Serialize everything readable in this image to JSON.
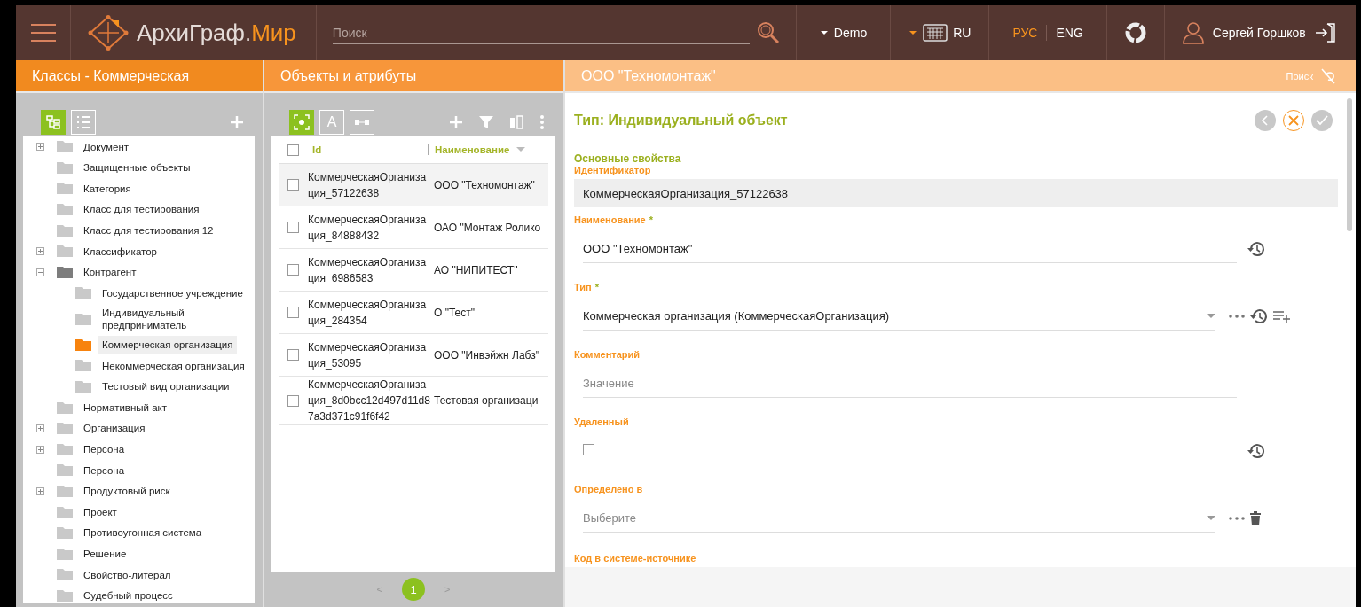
{
  "header": {
    "logo": {
      "name": "АрхиГраф.",
      "accent": "Мир"
    },
    "search": {
      "placeholder": "Поиск"
    },
    "workspace": "Demo",
    "keyboard": "RU",
    "languages": [
      {
        "label": "РУС",
        "selected": true
      },
      {
        "label": "ENG",
        "selected": false
      }
    ],
    "user": "Сергей Горшков"
  },
  "classes_panel": {
    "title": "Классы - Коммерческая",
    "views": [
      {
        "kind": "tree",
        "selected": true
      },
      {
        "kind": "list",
        "selected": false
      }
    ],
    "tree": [
      {
        "label": "Документ",
        "expanded": false
      },
      {
        "label": "Защищенные объекты"
      },
      {
        "label": "Категория"
      },
      {
        "label": "Класс для тестирования"
      },
      {
        "label": "Класс для тестирования 12"
      },
      {
        "label": "Классификатор",
        "expanded": false
      },
      {
        "label": "Контрагент",
        "expanded": true,
        "children": [
          {
            "label": "Государственное учреждение",
            "selected": false
          },
          {
            "label": "Индивидуальный предприниматель",
            "selected": false
          },
          {
            "label": "Коммерческая организация",
            "selected": true
          },
          {
            "label": "Некоммерческая организация",
            "selected": false
          },
          {
            "label": "Тестовый вид организации",
            "selected": false
          }
        ]
      },
      {
        "label": "Нормативный акт"
      },
      {
        "label": "Организация",
        "expanded": false
      },
      {
        "label": "Персона",
        "expanded": false
      },
      {
        "label": "Персона"
      },
      {
        "label": "Продуктовый риск",
        "expanded": false
      },
      {
        "label": "Проект"
      },
      {
        "label": "Противоугонная система"
      },
      {
        "label": "Решение"
      },
      {
        "label": "Свойство-литерал"
      },
      {
        "label": "Судебный процесс"
      }
    ]
  },
  "objects_panel": {
    "title": "Объекты и атрибуты",
    "views": [
      {
        "kind": "object",
        "selected": true
      },
      {
        "kind": "text",
        "label": "A",
        "selected": false
      },
      {
        "kind": "link",
        "selected": false
      }
    ],
    "table": {
      "columns": [
        "Id",
        "Наименование"
      ],
      "all_checked": false,
      "rows": [
        {
          "id": "КоммерческаяОрганизация_57122638",
          "name": "ООО \"Техномонтаж\"",
          "checked": false,
          "selected": true
        },
        {
          "id": "КоммерческаяОрганизация_84888432",
          "name": "ОАО \"Монтаж Ролико",
          "checked": false,
          "selected": false
        },
        {
          "id": "КоммерческаяОрганизация_6986583",
          "name": "АО \"НИПИТЕСТ\"",
          "checked": false,
          "selected": false
        },
        {
          "id": "КоммерческаяОрганизация_284354",
          "name": "О \"Тест\"",
          "checked": false,
          "selected": false
        },
        {
          "id": "КоммерческаяОрганизация_53095",
          "name": "ООО \"Инвэйжн Лабз\"",
          "checked": false,
          "selected": false
        },
        {
          "id": "КоммерческаяОрганизация_8d0bcc12d497d11d87a3d371c91f6f42",
          "name": "Тестовая организаци",
          "checked": false,
          "selected": false
        }
      ]
    },
    "pagination": {
      "prev": "<",
      "pages": [
        {
          "label": "1",
          "selected": true
        }
      ],
      "next": ">"
    }
  },
  "details_panel": {
    "title": "ООО \"Техномонтаж\"",
    "search": "Поиск",
    "heading": "Тип: Индивидуальный объект",
    "section": "Основные свойства",
    "fields": [
      {
        "kind": "readonly",
        "label": "Идентификатор",
        "value": "КоммерческаяОрганизация_57122638"
      },
      {
        "kind": "text",
        "label": "Наименование",
        "required_mark": "*",
        "value": "ООО \"Техномонтаж\"",
        "history": true
      },
      {
        "kind": "select",
        "label": "Тип",
        "required_mark": "*",
        "value": "Коммерческая организация (КоммерческаяОрганизация)",
        "history": true,
        "add": true
      },
      {
        "kind": "text",
        "label": "Комментарий",
        "placeholder": "Значение"
      },
      {
        "kind": "checkbox",
        "label": "Удаленный",
        "checked": false,
        "history": true
      },
      {
        "kind": "select",
        "label": "Определено в",
        "placeholder": "Выберите",
        "delete": true
      },
      {
        "kind": "label",
        "label": "Код в системе-источнике"
      }
    ]
  }
}
